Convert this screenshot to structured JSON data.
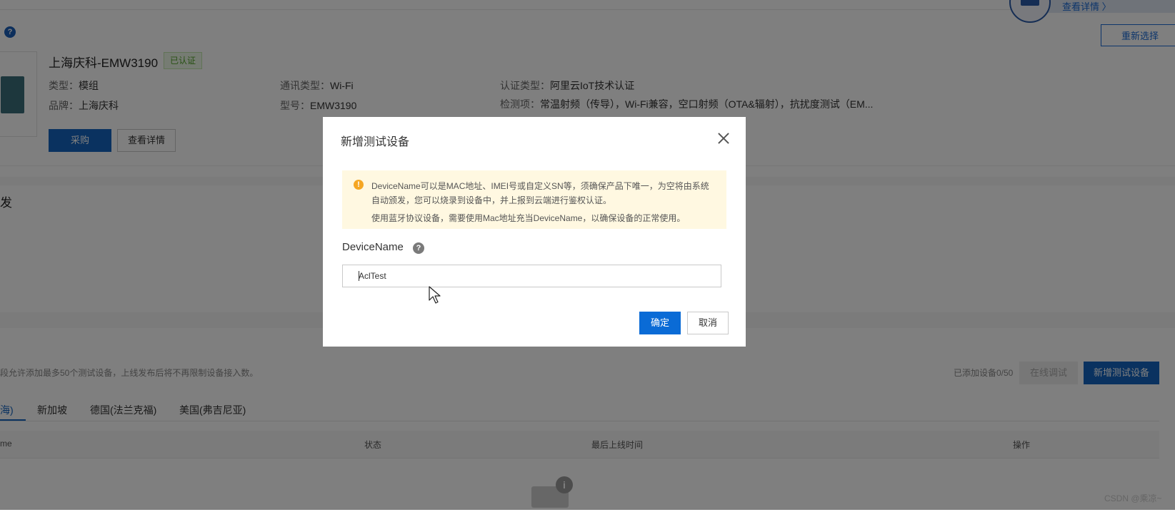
{
  "banner": {
    "link_label": "查看详情 〉"
  },
  "header": {
    "help_icon": "?",
    "reselect_label": "重新选择"
  },
  "product": {
    "title": "上海庆科-EMW3190",
    "badge": "已认证",
    "type_label": "类型：",
    "type_value": "模组",
    "brand_label": "品牌：",
    "brand_value": "上海庆科",
    "comm_label": "通讯类型：",
    "comm_value": "Wi-Fi",
    "model_label": "型号：",
    "model_value": "EMW3190",
    "cert_label": "认证类型：",
    "cert_value": "阿里云IoT技术认证",
    "test_label": "检测项：",
    "test_value": "常温射频（传导），Wi-Fi兼容，空口射频（OTA&辐射），抗扰度测试（EM...",
    "buy_label": "采购",
    "detail_label": "查看详情"
  },
  "section": {
    "title_fragment": "发"
  },
  "devices": {
    "note": "段允许添加最多50个测试设备，上线发布后将不再限制设备接入数。",
    "added_count": "已添加设备0/50",
    "online_debug_label": "在线调试",
    "add_device_label": "新增测试设备",
    "tabs": [
      "海)",
      "新加坡",
      "德国(法兰克福)",
      "美国(弗吉尼亚)"
    ],
    "columns": [
      "me",
      "状态",
      "最后上线时间",
      "操作"
    ],
    "empty_icon": "i"
  },
  "modal": {
    "title": "新增测试设备",
    "warning_icon": "!",
    "alert_line1": "DeviceName可以是MAC地址、IMEI号或自定义SN等，须确保产品下唯一，为空将由系统自动颁发，您可以烧录到设备中，并上报到云端进行鉴权认证。",
    "alert_line2": "使用蓝牙协议设备，需要使用Mac地址充当DeviceName，以确保设备的正常使用。",
    "field_label": "DeviceName",
    "help_icon": "?",
    "input_value": "AclTest",
    "ok_label": "确定",
    "cancel_label": "取消"
  },
  "watermark": "CSDN @乘凉~",
  "colors": {
    "primary": "#1565c0",
    "alert_bg": "#fff8e1",
    "warning": "#f5a623",
    "overlay": "rgba(0,0,0,0.5)"
  }
}
